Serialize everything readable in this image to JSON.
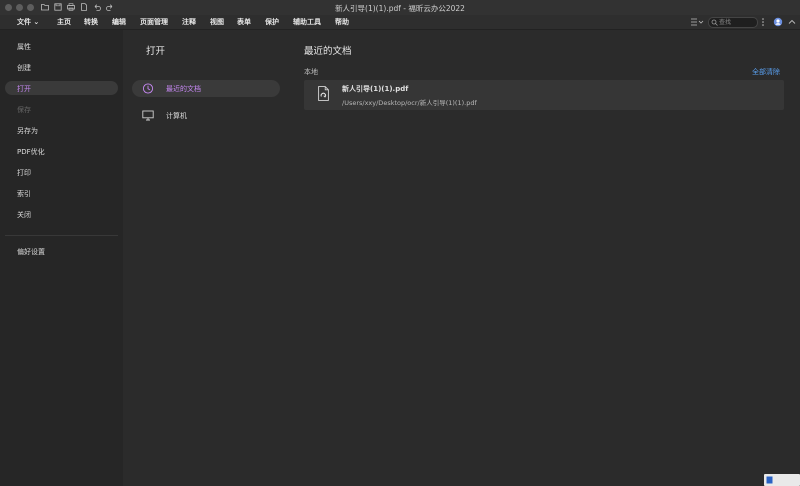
{
  "window": {
    "title": "新人引导(1)(1).pdf - 福昕云办公2022"
  },
  "menubar": {
    "items": [
      "文件 ⌄",
      "主页",
      "转换",
      "编辑",
      "页面管理",
      "注释",
      "视图",
      "表单",
      "保护",
      "辅助工具",
      "帮助"
    ],
    "search_placeholder": "查找"
  },
  "sidebar": {
    "items": [
      {
        "label": "属性",
        "state": "normal"
      },
      {
        "label": "创建",
        "state": "normal"
      },
      {
        "label": "打开",
        "state": "active"
      },
      {
        "label": "保存",
        "state": "disabled"
      },
      {
        "label": "另存为",
        "state": "normal"
      },
      {
        "label": "PDF优化",
        "state": "normal"
      },
      {
        "label": "打印",
        "state": "normal"
      },
      {
        "label": "索引",
        "state": "normal"
      },
      {
        "label": "关闭",
        "state": "normal"
      }
    ],
    "preferences": "偏好设置"
  },
  "open_panel": {
    "title": "打开",
    "options": [
      {
        "label": "最近的文档",
        "icon": "clock-icon",
        "active": true
      },
      {
        "label": "计算机",
        "icon": "monitor-icon",
        "active": false
      }
    ]
  },
  "recent": {
    "title": "最近的文档",
    "section": "本地",
    "clear_all": "全部清除",
    "files": [
      {
        "name": "新人引导(1)(1).pdf",
        "path": "/Users/xxy/Desktop/ocr/新人引导(1)(1).pdf"
      }
    ]
  },
  "colors": {
    "accent": "#c889f5",
    "link": "#5aa0f0",
    "background": "#2b2b2b",
    "sidebar": "#262626"
  }
}
